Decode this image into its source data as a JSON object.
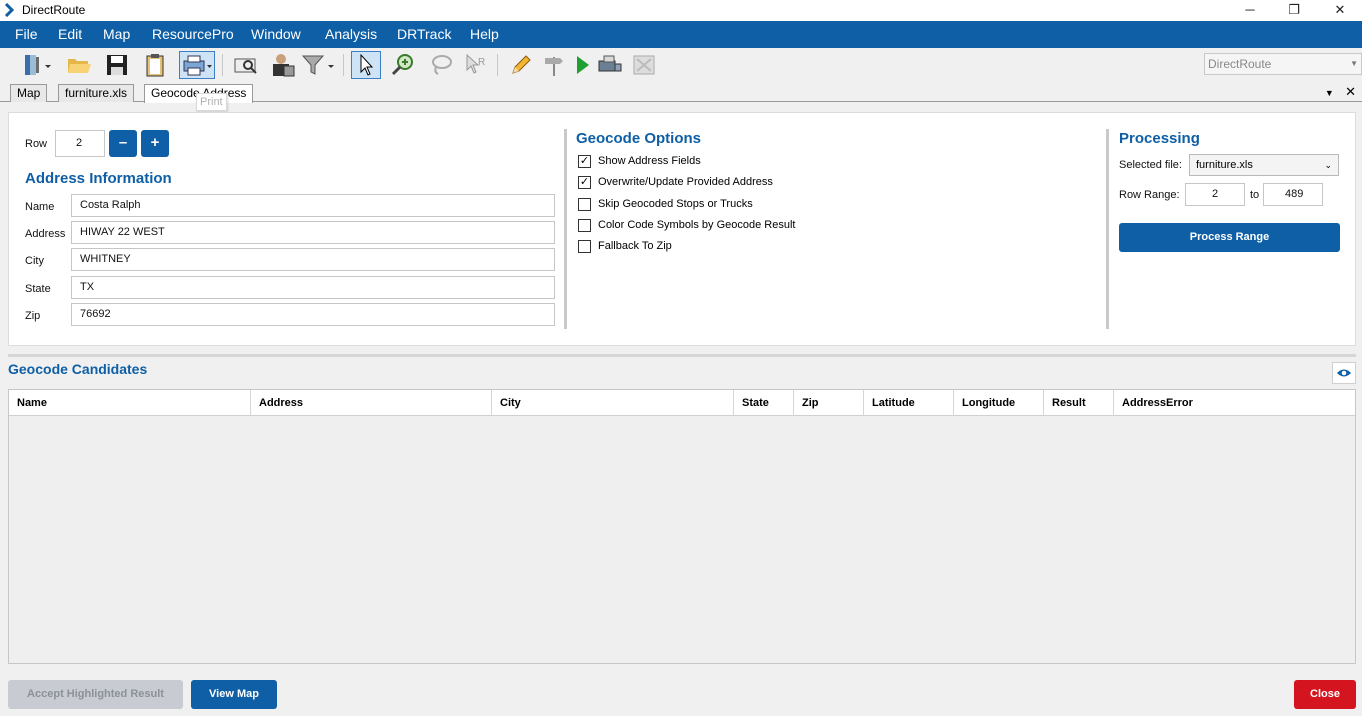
{
  "window": {
    "title": "DirectRoute",
    "minimize": "─",
    "maximize": "❐",
    "close": "✕"
  },
  "menu": [
    "File",
    "Edit",
    "Map",
    "ResourcePro",
    "Window",
    "Analysis",
    "DRTrack",
    "Help"
  ],
  "toolbar": {
    "workspace_value": "DirectRoute",
    "tooltip": "Print"
  },
  "tabs": [
    "Map",
    "furniture.xls",
    "Geocode Address"
  ],
  "row_nav": {
    "label": "Row",
    "value": "2",
    "minus": "–",
    "plus": "+"
  },
  "address": {
    "title": "Address Information",
    "fields": [
      {
        "label": "Name",
        "value": "Costa Ralph"
      },
      {
        "label": "Address",
        "value": "HIWAY 22 WEST"
      },
      {
        "label": "City",
        "value": "WHITNEY"
      },
      {
        "label": "State",
        "value": "TX"
      },
      {
        "label": "Zip",
        "value": "76692"
      }
    ]
  },
  "geocode_options": {
    "title": "Geocode Options",
    "items": [
      {
        "label": "Show Address Fields",
        "checked": true
      },
      {
        "label": "Overwrite/Update Provided Address",
        "checked": true
      },
      {
        "label": "Skip Geocoded Stops or Trucks",
        "checked": false
      },
      {
        "label": "Color Code Symbols by Geocode Result",
        "checked": false
      },
      {
        "label": "Fallback To Zip",
        "checked": false
      }
    ]
  },
  "processing": {
    "title": "Processing",
    "file_label": "Selected file:",
    "file_value": "furniture.xls",
    "range_label": "Row Range:",
    "range_from": "2",
    "range_to_label": "to",
    "range_to": "489",
    "process_button": "Process Range"
  },
  "candidates": {
    "title": "Geocode Candidates",
    "columns": [
      "Name",
      "Address",
      "City",
      "State",
      "Zip",
      "Latitude",
      "Longitude",
      "Result",
      "AddressError"
    ]
  },
  "footer": {
    "accept_button": "Accept Highlighted Result",
    "view_map_button": "View Map",
    "close_button": "Close"
  },
  "colors": {
    "brand_blue": "#0e5fa5",
    "close_red": "#d4141f",
    "disabled_gray": "#c8ccd2"
  }
}
